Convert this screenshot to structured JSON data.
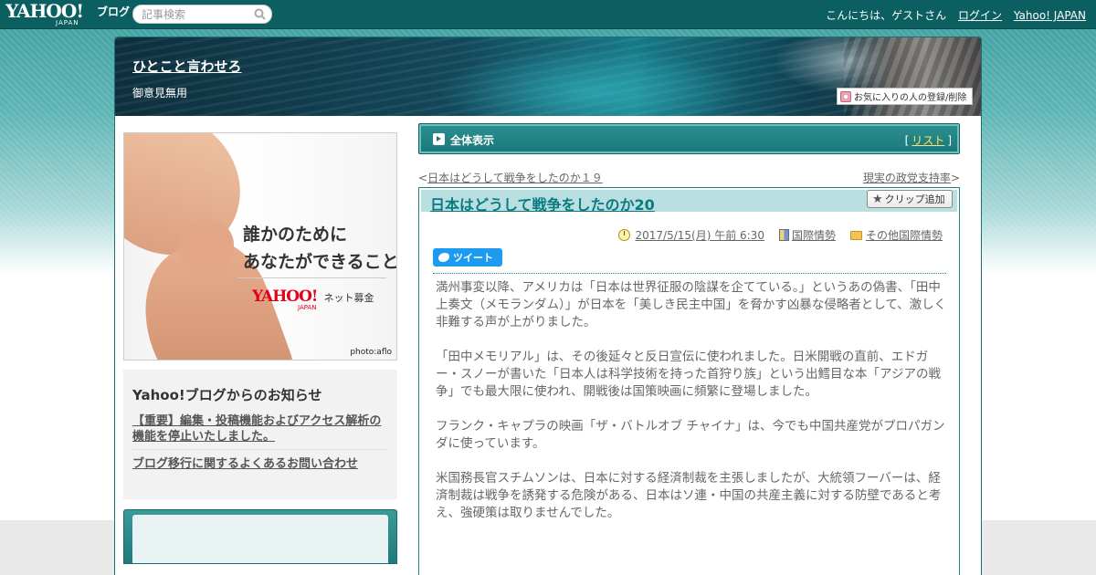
{
  "colors": {
    "topbar": "#0c5f60",
    "accent": "#1a7778",
    "title_link": "#0a7a80",
    "list_link": "#ffe36b",
    "tweet": "#1d9bf0"
  },
  "header": {
    "logo_main": "YAHOO!",
    "logo_sub": "JAPAN",
    "logo_blog": "ブログ",
    "search_placeholder": "記事検索",
    "greeting": "こんにちは、ゲストさん",
    "login": "ログイン",
    "yahoo_japan": "Yahoo! JAPAN"
  },
  "blog": {
    "title": "ひとこと言わせろ",
    "subtitle": "御意見無用",
    "fav_button": "お気に入りの人の登録/削除"
  },
  "ad": {
    "line1": "誰かのために",
    "line2": "あなたができること",
    "logo_main": "YAHOO!",
    "logo_sub": "JAPAN",
    "service": "ネット募金",
    "credit": "photo:aflo"
  },
  "notice": {
    "heading": "Yahoo!ブログからのお知らせ",
    "items": [
      "【重要】編集・投稿機能およびアクセス解析の機能を停止いたしました。",
      "ブログ移行に関するよくあるお問い合わせ"
    ]
  },
  "view_bar": {
    "label": "全体表示",
    "bracket_open": "[",
    "list_link": "リスト",
    "bracket_close": "]"
  },
  "pager": {
    "prev_mark": "<",
    "prev": "日本はどうして戦争をしたのか１９",
    "next": "現実の政党支持率",
    "next_mark": ">"
  },
  "article": {
    "title": "日本はどうして戦争をしたのか20",
    "clip_button": "クリップ追加",
    "date": "2017/5/15(月) 午前 6:30",
    "category1": "国際情勢",
    "category2": "その他国際情勢",
    "tweet_button": "ツイート",
    "paragraphs": [
      "満州事変以降、アメリカは「日本は世界征服の陰謀を企てている。」というあの偽書、「田中上奏文（メモランダム）」が日本を「美しき民主中国」を脅かす凶暴な侵略者として、激しく非難する声が上がりました。",
      "「田中メモリアル」は、その後延々と反日宣伝に使われました。日米開戦の直前、エドガー・スノーが書いた「日本人は科学技術を持った首狩り族」という出鱈目な本「アジアの戦争」でも最大限に使われ、開戦後は国策映画に頻繁に登場しました。",
      "フランク・キャプラの映画「ザ・バトルオブ チャイナ」は、今でも中国共産党がプロパガンダに使っています。",
      "米国務長官スチムソンは、日本に対する経済制裁を主張しましたが、大統領フーバーは、経済制裁は戦争を誘発する危険がある、日本はソ連・中国の共産主義に対する防壁であると考え、強硬策は取りませんでした。"
    ]
  }
}
